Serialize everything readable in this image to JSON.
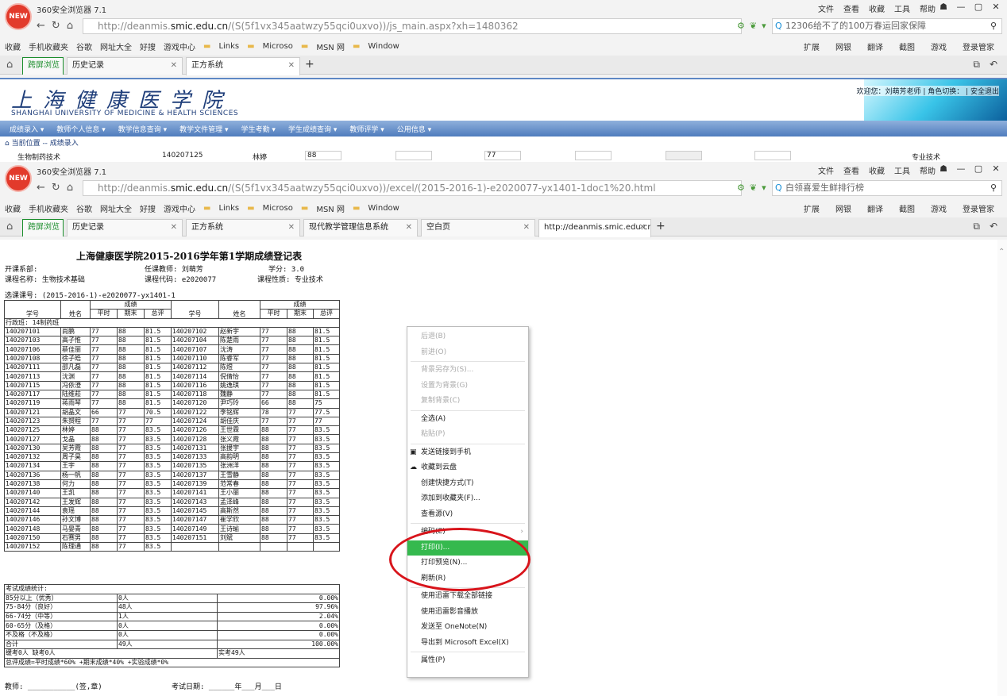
{
  "browser1": {
    "app_title": "360安全浏览器 7.1",
    "logo_text": "NEW",
    "menu": [
      "文件",
      "查看",
      "收藏",
      "工具",
      "帮助"
    ],
    "url_prefix": "http://deanmis.",
    "url_domain": "smic.edu.cn",
    "url_rest": "/(S(5f1vx345aatwzy55qci0uxvo))/js_main.aspx?xh=1480362",
    "search_text": "12306给不了的100万春运回家保障",
    "bookmarks": [
      "收藏",
      "手机收藏夹",
      "谷歌",
      "网址大全",
      "好搜",
      "游戏中心",
      "Links",
      "Microso",
      "MSN 网",
      "Window"
    ],
    "bookmarks_right": [
      "扩展",
      "网银",
      "翻译",
      "截图",
      "游戏",
      "登录管家"
    ],
    "tabs": [
      {
        "label": "跨屏浏览"
      },
      {
        "label": "历史记录"
      },
      {
        "label": "正方系统"
      }
    ]
  },
  "site": {
    "name_cn": "上海健康医学院",
    "name_en": "SHANGHAI UNIVERSITY OF MEDICINE & HEALTH SCIENCES",
    "welcome": "欢迎您：刘萌芳老师 | 角色切换： | 安全退出",
    "nav": [
      "成绩录入 ▾",
      "教师个人信息 ▾",
      "教学信息查询 ▾",
      "教学文件管理 ▾",
      "学生考勤 ▾",
      "学生成绩查询 ▾",
      "教师评学 ▾",
      "公用信息 ▾"
    ],
    "breadcrumb": "当前位置 -- 成绩录入",
    "strip": {
      "course": "生物制药技术",
      "id": "140207125",
      "name": "林婷",
      "s1": "88",
      "s2": "77",
      "type": "专业技术"
    }
  },
  "browser2": {
    "app_title": "360安全浏览器 7.1",
    "logo_text": "NEW",
    "menu": [
      "文件",
      "查看",
      "收藏",
      "工具",
      "帮助"
    ],
    "url_prefix": "http://deanmis.",
    "url_domain": "smic.edu.cn",
    "url_rest": "/(S(5f1vx345aatwzy55qci0uxvo))/excel/(2015-2016-1)-e2020077-yx1401-1doc1%20.html",
    "search_text": "白领喜爱生鲜排行榜",
    "bookmarks": [
      "收藏",
      "手机收藏夹",
      "谷歌",
      "网址大全",
      "好搜",
      "游戏中心",
      "Links",
      "Microso",
      "MSN 网",
      "Window"
    ],
    "bookmarks_right": [
      "扩展",
      "网银",
      "翻译",
      "截图",
      "游戏",
      "登录管家"
    ],
    "tabs": [
      {
        "label": "跨屏浏览"
      },
      {
        "label": "历史记录"
      },
      {
        "label": "正方系统"
      },
      {
        "label": "现代教学管理信息系统"
      },
      {
        "label": "空白页"
      },
      {
        "label": "http://deanmis.smic.edu.cn/("
      }
    ]
  },
  "report": {
    "title": "上海健康医学院2015-2016学年第1学期成绩登记表",
    "dept": "开课系部:",
    "teacher": "任课教师: 刘萌芳",
    "credit": "学分: 3.0",
    "course": "课程名称: 生物技术基础",
    "code": "课程代码: e2020077",
    "nature": "课程性质: 专业技术",
    "select_no": "选课课号: (2015-2016-1)-e2020077-yx1401-1",
    "headers": {
      "id": "学号",
      "name": "姓名",
      "grade": "成绩",
      "usual": "平时",
      "final": "期末",
      "total": "总评"
    },
    "class_row": "行政班: 14制药班",
    "rows": [
      [
        "140207101",
        "尚鹏",
        "77",
        "88",
        "81.5",
        "140207102",
        "赵新宇",
        "77",
        "88",
        "81.5"
      ],
      [
        "140207103",
        "高子惟",
        "77",
        "88",
        "81.5",
        "140207104",
        "陈楚雨",
        "77",
        "88",
        "81.5"
      ],
      [
        "140207106",
        "蔡佳丽",
        "77",
        "88",
        "81.5",
        "140207107",
        "沈涛",
        "77",
        "88",
        "81.5"
      ],
      [
        "140207108",
        "徐子皓",
        "77",
        "88",
        "81.5",
        "140207110",
        "陈睿军",
        "77",
        "88",
        "81.5"
      ],
      [
        "140207111",
        "邵凡磊",
        "77",
        "88",
        "81.5",
        "140207112",
        "陈煜",
        "77",
        "88",
        "81.5"
      ],
      [
        "140207113",
        "沈渊",
        "77",
        "88",
        "81.5",
        "140207114",
        "倪倩怡",
        "77",
        "88",
        "81.5"
      ],
      [
        "140207115",
        "冯依澄",
        "77",
        "88",
        "81.5",
        "140207116",
        "姚逸琪",
        "77",
        "88",
        "81.5"
      ],
      [
        "140207117",
        "陆维菘",
        "77",
        "88",
        "81.5",
        "140207118",
        "魏静",
        "77",
        "88",
        "81.5"
      ],
      [
        "140207119",
        "蒋雨琴",
        "77",
        "88",
        "81.5",
        "140207120",
        "尹巧玲",
        "66",
        "88",
        "75"
      ],
      [
        "140207121",
        "胡晶文",
        "66",
        "77",
        "70.5",
        "140207122",
        "李铭辉",
        "78",
        "77",
        "77.5"
      ],
      [
        "140207123",
        "朱赟程",
        "77",
        "77",
        "77",
        "140207124",
        "胡佳庆",
        "77",
        "77",
        "77"
      ],
      [
        "140207125",
        "林婷",
        "88",
        "77",
        "83.5",
        "140207126",
        "王世霖",
        "88",
        "77",
        "83.5"
      ],
      [
        "140207127",
        "戈晶",
        "88",
        "77",
        "83.5",
        "140207128",
        "张义霞",
        "88",
        "77",
        "83.5"
      ],
      [
        "140207130",
        "吴芳霞",
        "88",
        "77",
        "83.5",
        "140207131",
        "张援宇",
        "88",
        "77",
        "83.5"
      ],
      [
        "140207132",
        "周子昊",
        "88",
        "77",
        "83.5",
        "140207133",
        "高韵明",
        "88",
        "77",
        "83.5"
      ],
      [
        "140207134",
        "王宇",
        "88",
        "77",
        "83.5",
        "140207135",
        "张洲洋",
        "88",
        "77",
        "83.5"
      ],
      [
        "140207136",
        "杨一帆",
        "88",
        "77",
        "83.5",
        "140207137",
        "王雪静",
        "88",
        "77",
        "83.5"
      ],
      [
        "140207138",
        "何力",
        "88",
        "77",
        "83.5",
        "140207139",
        "范常春",
        "88",
        "77",
        "83.5"
      ],
      [
        "140207140",
        "王凯",
        "88",
        "77",
        "83.5",
        "140207141",
        "王小丽",
        "88",
        "77",
        "83.5"
      ],
      [
        "140207142",
        "王发辉",
        "88",
        "77",
        "83.5",
        "140207143",
        "孟泽峰",
        "88",
        "77",
        "83.5"
      ],
      [
        "140207144",
        "袁瑶",
        "88",
        "77",
        "83.5",
        "140207145",
        "高斯然",
        "88",
        "77",
        "83.5"
      ],
      [
        "140207146",
        "孙文博",
        "88",
        "77",
        "83.5",
        "140207147",
        "崔学欣",
        "88",
        "77",
        "83.5"
      ],
      [
        "140207148",
        "马晏青",
        "88",
        "77",
        "83.5",
        "140207149",
        "王诗瑜",
        "88",
        "77",
        "83.5"
      ],
      [
        "140207150",
        "石赛男",
        "88",
        "77",
        "83.5",
        "140207151",
        "刘斌",
        "88",
        "77",
        "83.5"
      ],
      [
        "140207152",
        "陈理通",
        "88",
        "77",
        "83.5",
        "",
        "",
        "",
        "",
        ""
      ]
    ],
    "stats_title": "考试成绩统计:",
    "stats": [
      [
        "85分以上（优秀）",
        "0人",
        "0.00%"
      ],
      [
        "75-84分（良好）",
        "48人",
        "97.96%"
      ],
      [
        "66-74分（中等）",
        "1人",
        "2.04%"
      ],
      [
        "60-65分（及格）",
        "0人",
        "0.00%"
      ],
      [
        "不及格（不及格）",
        "0人",
        "0.00%"
      ],
      [
        "合计",
        "49人",
        "100.00%"
      ]
    ],
    "absent": "缓考0人  缺考0人",
    "actual": "实考49人",
    "formula": "总评成绩=平时成绩*60%  +期末成绩*40%  +实验成绩*0%",
    "teacher_sign": "教师: ___________(签,章)",
    "exam_date": "考试日期: ______年___月___日"
  },
  "context_menu": [
    {
      "label": "后退(B)",
      "disabled": true
    },
    {
      "label": "前进(O)",
      "disabled": true
    },
    {
      "sep": true
    },
    {
      "label": "背景另存为(S)...",
      "disabled": true
    },
    {
      "label": "设置为背景(G)",
      "disabled": true
    },
    {
      "label": "复制背景(C)",
      "disabled": true
    },
    {
      "sep": true
    },
    {
      "label": "全选(A)"
    },
    {
      "label": "粘贴(P)",
      "disabled": true
    },
    {
      "sep": true
    },
    {
      "label": "发送链接到手机",
      "icon": "▣"
    },
    {
      "label": "收藏到云盘",
      "icon": "☁"
    },
    {
      "label": "创建快捷方式(T)"
    },
    {
      "label": "添加到收藏夹(F)..."
    },
    {
      "label": "查看源(V)"
    },
    {
      "sep": true
    },
    {
      "label": "编码(E)",
      "submenu": true
    },
    {
      "label": "打印(I)...",
      "highlight": true
    },
    {
      "label": "打印预览(N)..."
    },
    {
      "label": "刷新(R)"
    },
    {
      "sep": true
    },
    {
      "label": "使用迅雷下载全部链接"
    },
    {
      "label": "使用迅雷影音播放"
    },
    {
      "label": "发送至 OneNote(N)"
    },
    {
      "label": "导出到 Microsoft Excel(X)"
    },
    {
      "sep": true
    },
    {
      "label": "属性(P)"
    }
  ],
  "colors": {
    "accent": "#35b94e",
    "annotation": "#d8141b",
    "site_blue": "#1f3e7a"
  }
}
